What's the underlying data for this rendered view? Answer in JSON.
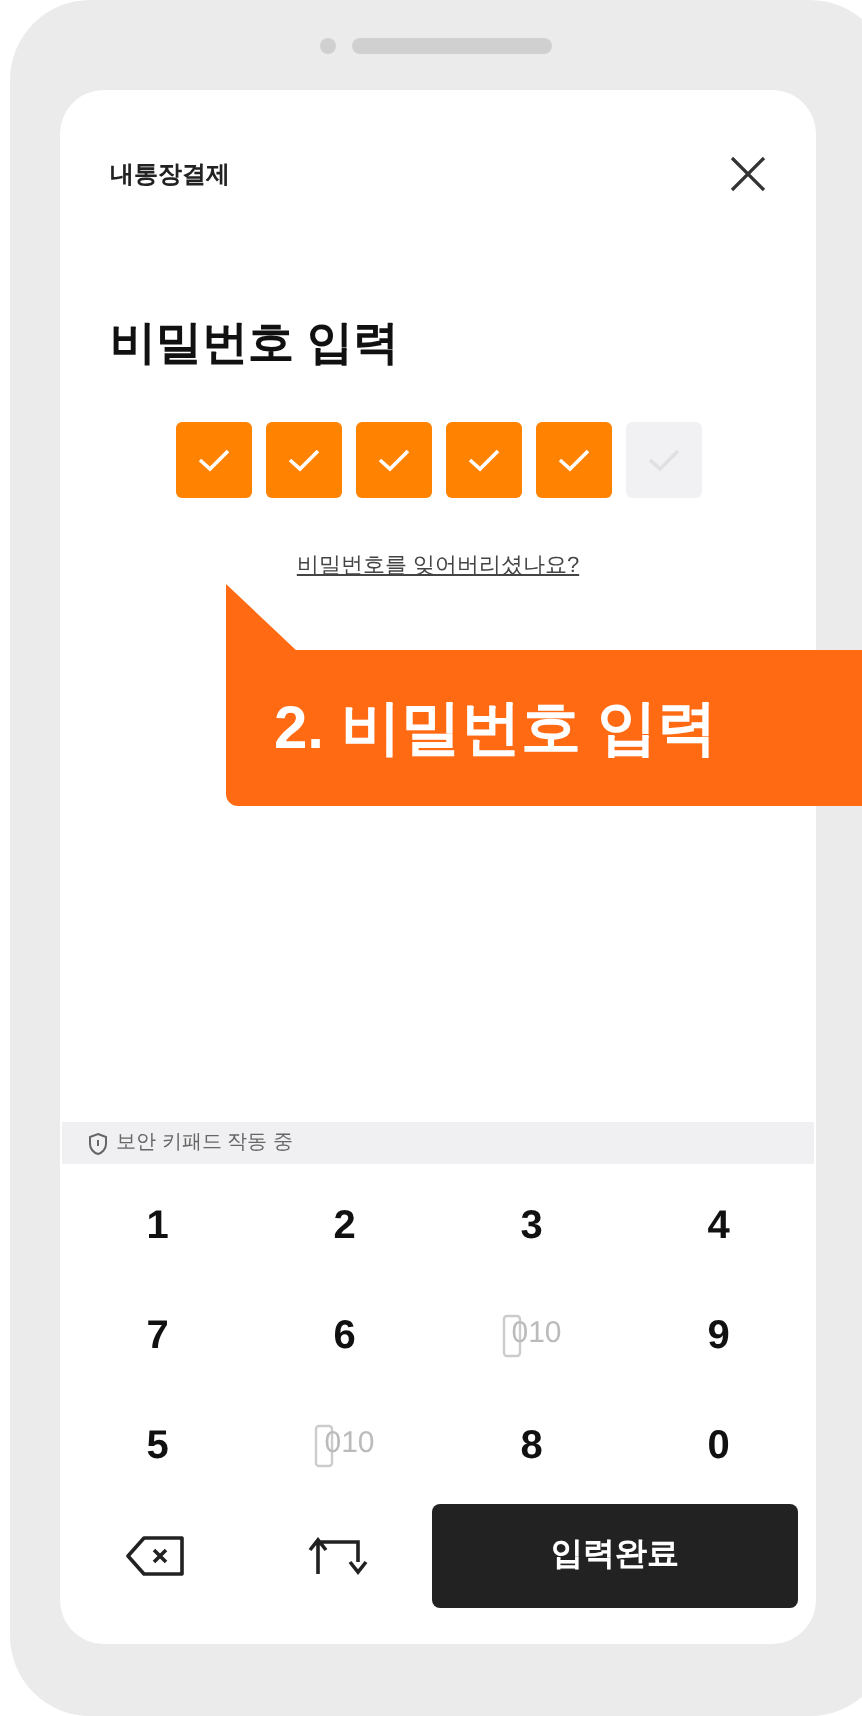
{
  "header": {
    "title": "내통장결제"
  },
  "heading": "비밀번호 입력",
  "pin": [
    {
      "filled": true
    },
    {
      "filled": true
    },
    {
      "filled": true
    },
    {
      "filled": true
    },
    {
      "filled": true
    },
    {
      "filled": false
    }
  ],
  "forgot_link": "비밀번호를 잊어버리셨나요?",
  "callout": "2. 비밀번호 입력",
  "secure_notice": "보안 키패드 작동 중",
  "keys": [
    {
      "kind": "digit",
      "label": "1"
    },
    {
      "kind": "digit",
      "label": "2"
    },
    {
      "kind": "digit",
      "label": "3"
    },
    {
      "kind": "digit",
      "label": "4"
    },
    {
      "kind": "digit",
      "label": "7"
    },
    {
      "kind": "digit",
      "label": "6"
    },
    {
      "kind": "blank",
      "label": "010"
    },
    {
      "kind": "digit",
      "label": "9"
    },
    {
      "kind": "digit",
      "label": "5"
    },
    {
      "kind": "blank",
      "label": "010"
    },
    {
      "kind": "digit",
      "label": "8"
    },
    {
      "kind": "digit",
      "label": "0"
    }
  ],
  "bottom_keys": [
    {
      "kind": "backspace"
    },
    {
      "kind": "shuffle"
    },
    {
      "kind": "submit",
      "label": "입력완료"
    }
  ]
}
